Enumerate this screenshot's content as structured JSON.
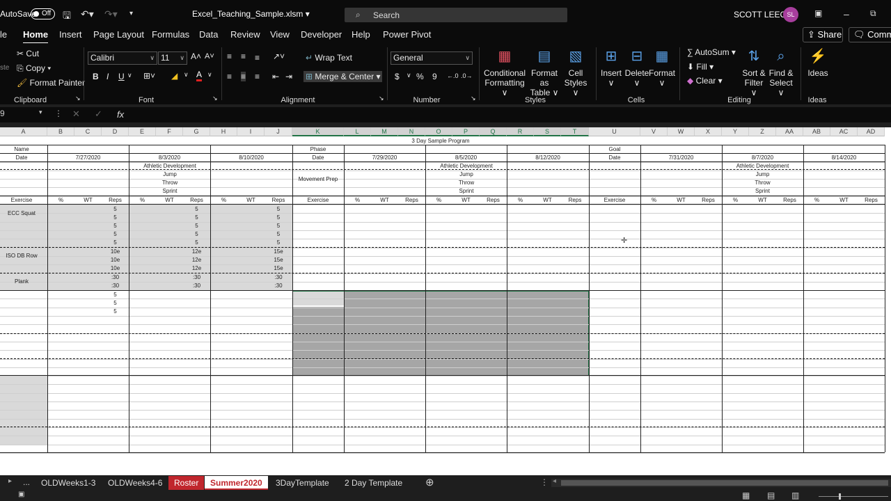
{
  "titlebar": {
    "autosave_label": "AutoSave",
    "autosave_state": "Off",
    "file_name": "Excel_Teaching_Sample.xlsm",
    "search_placeholder": "Search",
    "user_name": "SCOTT LEECH",
    "user_initials": "SL"
  },
  "menu": {
    "items": [
      "le",
      "Home",
      "Insert",
      "Page Layout",
      "Formulas",
      "Data",
      "Review",
      "View",
      "Developer",
      "Help",
      "Power Pivot"
    ],
    "active": "Home",
    "share_label": "Share",
    "comments_label": "Comme"
  },
  "ribbon": {
    "clipboard": {
      "cut": "Cut",
      "copy": "Copy",
      "format_painter": "Format Painter",
      "group": "Clipboard",
      "paste_label": "ste"
    },
    "font": {
      "name": "Calibri",
      "size": "11",
      "group": "Font",
      "bold": "B",
      "italic": "I",
      "underline": "U"
    },
    "alignment": {
      "wrap_text": "Wrap Text",
      "merge_center": "Merge & Center",
      "group": "Alignment"
    },
    "number": {
      "format": "General",
      "group": "Number",
      "currency": "$",
      "percent": "%",
      "comma": "9"
    },
    "styles": {
      "conditional": "Conditional",
      "conditional2": "Formatting",
      "format_table": "Format as",
      "format_table2": "Table",
      "cell_styles": "Cell",
      "cell_styles2": "Styles",
      "group": "Styles"
    },
    "cells": {
      "insert": "Insert",
      "delete": "Delete",
      "format": "Format",
      "group": "Cells"
    },
    "editing": {
      "autosum": "AutoSum",
      "fill": "Fill",
      "clear": "Clear",
      "sort": "Sort &",
      "sort2": "Filter",
      "find": "Find &",
      "find2": "Select",
      "group": "Editing"
    },
    "ideas": {
      "label": "Ideas",
      "group": "Ideas"
    }
  },
  "formula_bar": {
    "name_box": "9",
    "fx": "fx",
    "value": ""
  },
  "sheet": {
    "columns": [
      "A",
      "B",
      "C",
      "D",
      "E",
      "F",
      "G",
      "H",
      "I",
      "J",
      "K",
      "L",
      "M",
      "N",
      "O",
      "P",
      "Q",
      "R",
      "S",
      "T",
      "U",
      "V",
      "W",
      "X",
      "Y",
      "Z",
      "AA",
      "AB",
      "AC",
      "AD"
    ],
    "title": "3 Day Sample Program",
    "left_labels": {
      "name": "Name",
      "date": "Date",
      "exercise": "Exercise"
    },
    "mid_labels": {
      "phase": "Phase",
      "date": "Date",
      "movement": "Movement Prep",
      "exercise": "Exercise"
    },
    "right_labels": {
      "goal": "Goal",
      "date": "Date",
      "exercise": "Exercise"
    },
    "dates_block1": [
      "7/27/2020",
      "8/3/2020",
      "8/10/2020"
    ],
    "dates_block2": [
      "7/29/2020",
      "8/5/2020",
      "8/12/2020"
    ],
    "dates_block3": [
      "7/31/2020",
      "8/7/2020",
      "8/14/2020"
    ],
    "warmup": [
      "Athletic Development",
      "Jump",
      "Throw",
      "Sprint"
    ],
    "sub_headers": [
      "%",
      "WT",
      "Reps"
    ],
    "exercises": [
      "ECC Squat",
      "ISO DB Row",
      "Plank"
    ],
    "reps_week1": [
      "5",
      "5",
      "5",
      "5",
      "5",
      "10e",
      "10e",
      "10e",
      ":30",
      ":30",
      "5",
      "5",
      "5"
    ],
    "reps_week2": [
      "5",
      "5",
      "5",
      "5",
      "5",
      "12e",
      "12e",
      "12e",
      ":30",
      ":30"
    ],
    "reps_week3": [
      "5",
      "5",
      "5",
      "5",
      "5",
      "15e",
      "15e",
      "15e",
      ":30",
      ":30"
    ]
  },
  "tabs": {
    "ellipsis": "...",
    "items": [
      "OLDWeeks1-3",
      "OLDWeeks4-6",
      "Roster",
      "Summer2020",
      "3DayTemplate",
      "2 Day Template"
    ],
    "active": "Summer2020",
    "red": "Roster"
  }
}
